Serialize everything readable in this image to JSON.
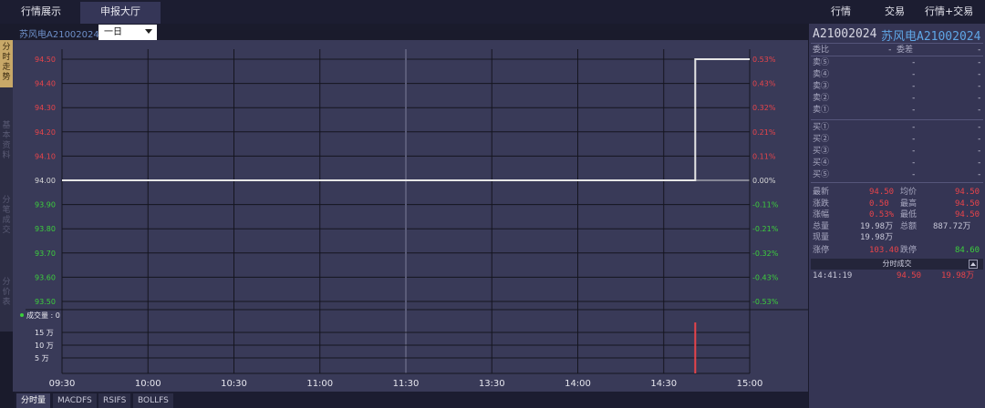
{
  "topbar": {
    "tabs": [
      "行情展示",
      "申报大厅"
    ],
    "menus": [
      "行情",
      "交易",
      "行情+交易"
    ]
  },
  "left_tabs": [
    "分时走势",
    "基本资料",
    "分笔成交",
    "分价表"
  ],
  "subbar": {
    "stock_label": "苏风电A21002024",
    "period": "一日"
  },
  "volume_label": "成交量 : 0",
  "bottom_tabs": [
    "分时量",
    "MACDFS",
    "RSIFS",
    "BOLLFS"
  ],
  "colors": {
    "up": "#e8444a",
    "down": "#3ccf3c",
    "price_line": "#e6e6e6",
    "accent": "#c8a868"
  },
  "chart_data": {
    "type": "line",
    "price_ticks": [
      "94.50",
      "94.40",
      "94.30",
      "94.20",
      "94.10",
      "94.00",
      "93.90",
      "93.80",
      "93.70",
      "93.60",
      "93.50"
    ],
    "pct_ticks": [
      "0.53%",
      "0.43%",
      "0.32%",
      "0.21%",
      "0.11%",
      "0.00%",
      "-0.11%",
      "-0.21%",
      "-0.32%",
      "-0.43%",
      "-0.53%"
    ],
    "time_labels": [
      "09:30",
      "10:00",
      "10:30",
      "11:00",
      "11:30",
      "13:30",
      "14:00",
      "14:30",
      "15:00"
    ],
    "volume_ticks": [
      "15 万",
      "10 万",
      "5 万"
    ],
    "ylim": [
      93.5,
      94.5
    ],
    "volume_ylim": [
      0,
      200000
    ],
    "price_series": [
      {
        "t": "09:30",
        "price": 94.0
      },
      {
        "t": "14:41",
        "price": 94.0
      },
      {
        "t": "14:41",
        "price": 94.5
      },
      {
        "t": "15:00",
        "price": 94.5
      }
    ],
    "avg_price": 94.5,
    "volume_bars": [
      {
        "t": "14:41",
        "volume": 199800
      }
    ]
  },
  "quote": {
    "code": "A21002024",
    "name": "苏风电A21002024",
    "weibi_label": "委比",
    "weicha_label": "委差",
    "weibi_value": "-",
    "weicha_value": "-",
    "sells": [
      {
        "label": "卖⑤",
        "price": "-",
        "vol": "-"
      },
      {
        "label": "卖④",
        "price": "-",
        "vol": "-"
      },
      {
        "label": "卖③",
        "price": "-",
        "vol": "-"
      },
      {
        "label": "卖②",
        "price": "-",
        "vol": "-"
      },
      {
        "label": "卖①",
        "price": "-",
        "vol": "-"
      }
    ],
    "buys": [
      {
        "label": "买①",
        "price": "-",
        "vol": "-"
      },
      {
        "label": "买②",
        "price": "-",
        "vol": "-"
      },
      {
        "label": "买③",
        "price": "-",
        "vol": "-"
      },
      {
        "label": "买④",
        "price": "-",
        "vol": "-"
      },
      {
        "label": "买⑤",
        "price": "-",
        "vol": "-"
      }
    ],
    "stats": [
      {
        "l1": "最新",
        "v1": "94.50",
        "l2": "均价",
        "v2": "94.50"
      },
      {
        "l1": "涨跌",
        "v1": "0.50",
        "l2": "最高",
        "v2": "94.50"
      },
      {
        "l1": "涨幅",
        "v1": "0.53%",
        "l2": "最低",
        "v2": "94.50"
      },
      {
        "l1": "总量",
        "v1": "19.98万",
        "l2": "总额",
        "v2": "887.72万"
      },
      {
        "l1": "现量",
        "v1": "19.98万",
        "l2": "",
        "v2": ""
      }
    ],
    "limits": {
      "up_label": "涨停",
      "up": "103.40",
      "down_label": "跌停",
      "down": "84.60"
    },
    "ticks_header": "分时成交",
    "ticks": [
      {
        "time": "14:41:19",
        "price": "94.50",
        "vol": "19.98万"
      }
    ]
  }
}
